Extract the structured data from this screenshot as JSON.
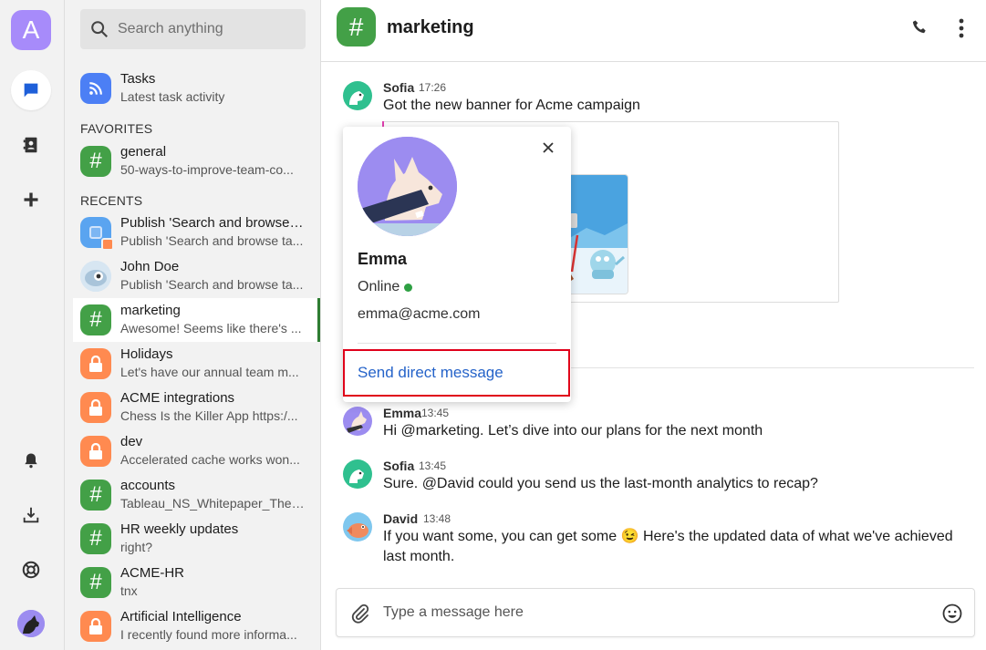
{
  "rail": {
    "account_initial": "A",
    "items": [
      "chats-icon",
      "contacts-icon",
      "add-icon",
      "notifications-icon",
      "download-icon",
      "help-icon"
    ]
  },
  "sidebar": {
    "search_placeholder": "Search anything",
    "tasks": {
      "title": "Tasks",
      "subtitle": "Latest task activity"
    },
    "favorites_label": "FAVORITES",
    "favorites": [
      {
        "title": "general",
        "subtitle": "50-ways-to-improve-team-co...",
        "icon": "hash-icon"
      }
    ],
    "recents_label": "RECENTS",
    "recents": [
      {
        "title": "Publish 'Search and browse ...",
        "subtitle": "Publish 'Search and browse ta...",
        "icon": "task-icon"
      },
      {
        "title": "John Doe",
        "subtitle": "Publish 'Search and browse ta...",
        "icon": "avatar"
      },
      {
        "title": "marketing",
        "subtitle": "Awesome! Seems like there's ...",
        "icon": "hash-icon"
      },
      {
        "title": "Holidays",
        "subtitle": "Let's have our annual team m...",
        "icon": "lock-icon"
      },
      {
        "title": "ACME integrations",
        "subtitle": "Chess Is the Killer App https:/...",
        "icon": "lock-icon"
      },
      {
        "title": "dev",
        "subtitle": "Accelerated cache works won...",
        "icon": "lock-icon"
      },
      {
        "title": "accounts",
        "subtitle": "Tableau_NS_Whitepaper_The_...",
        "icon": "hash-icon"
      },
      {
        "title": "HR weekly updates",
        "subtitle": "right?",
        "icon": "hash-icon"
      },
      {
        "title": "ACME-HR",
        "subtitle": "tnx",
        "icon": "hash-icon"
      },
      {
        "title": "Artificial Intelligence",
        "subtitle": "I recently found more informa...",
        "icon": "lock-icon"
      }
    ]
  },
  "header": {
    "channel": "marketing"
  },
  "messages": [
    {
      "author": "Sofia",
      "time": "17:26",
      "text": "Got the new banner for Acme campaign"
    },
    {
      "author": "Emma",
      "time": "13:45",
      "text": "Hi @marketing. Let’s dive into our plans for the next month"
    },
    {
      "author": "Sofia",
      "time": "13:45",
      "text": "Sure. @David could you send us the last-month analytics to recap?"
    },
    {
      "author": "David",
      "time": "13:48",
      "text": "If you want some, you can get some 😉 Here's the updated data of what we've achieved last month."
    }
  ],
  "composer": {
    "placeholder": "Type a message here"
  },
  "profile_popup": {
    "name": "Emma",
    "status": "Online",
    "email": "emma@acme.com",
    "action": "Send direct message"
  },
  "colors": {
    "accent_green": "#43a047",
    "lock_orange": "#ff8a50",
    "link_blue": "#2563c9",
    "highlight_red": "#e0001a",
    "rail_purple": "#a78bfa"
  }
}
